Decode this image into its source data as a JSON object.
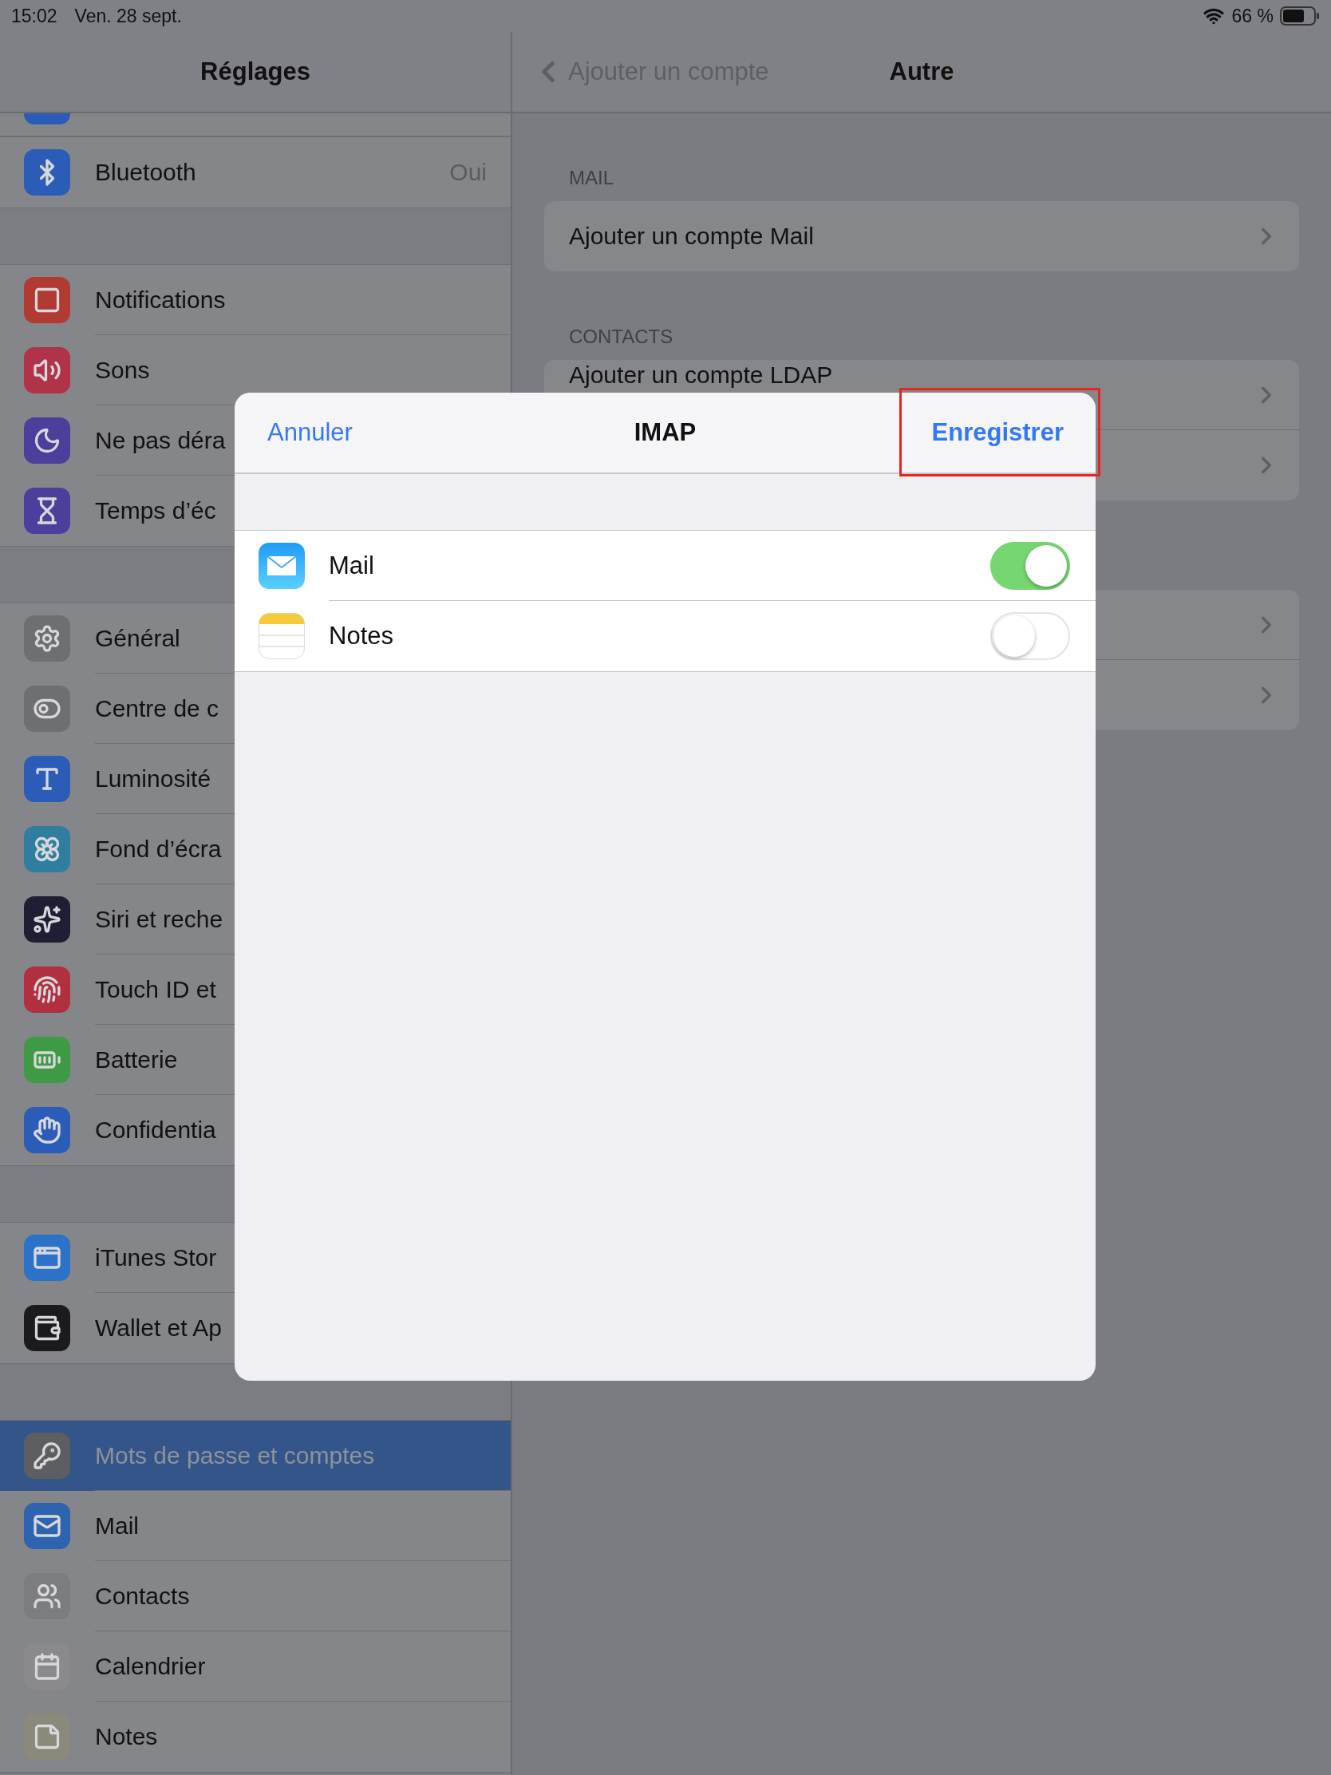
{
  "status_bar": {
    "time": "15:02",
    "date": "Ven. 28 sept.",
    "battery": "66 %"
  },
  "sidebar": {
    "title": "Réglages",
    "groups": [
      {
        "items": [
          {
            "label": "Bluetooth",
            "value": "Oui",
            "selected": false
          }
        ]
      },
      {
        "items": [
          {
            "label": "Notifications",
            "selected": false
          },
          {
            "label": "Sons",
            "selected": false
          },
          {
            "label": "Ne pas déra",
            "selected": false
          },
          {
            "label": "Temps d’éc",
            "selected": false
          }
        ]
      },
      {
        "items": [
          {
            "label": "Général",
            "selected": false
          },
          {
            "label": "Centre de c",
            "selected": false
          },
          {
            "label": "Luminosité",
            "selected": false
          },
          {
            "label": "Fond d’écra",
            "selected": false
          },
          {
            "label": "Siri et reche",
            "selected": false
          },
          {
            "label": "Touch ID et",
            "selected": false
          },
          {
            "label": "Batterie",
            "selected": false
          },
          {
            "label": "Confidentia",
            "selected": false
          }
        ]
      },
      {
        "items": [
          {
            "label": "iTunes Stor",
            "selected": false
          },
          {
            "label": "Wallet et Ap",
            "selected": false
          }
        ]
      },
      {
        "items": [
          {
            "label": "Mots de passe et comptes",
            "selected": true
          },
          {
            "label": "Mail",
            "selected": false
          },
          {
            "label": "Contacts",
            "selected": false
          },
          {
            "label": "Calendrier",
            "selected": false
          },
          {
            "label": "Notes",
            "selected": false
          }
        ]
      }
    ]
  },
  "detail": {
    "back": "Ajouter un compte",
    "title": "Autre",
    "sections": [
      {
        "header": "MAIL",
        "rows": [
          "Ajouter un compte Mail"
        ]
      },
      {
        "header": "CONTACTS",
        "rows": [
          "Ajouter un compte LDAP",
          ""
        ]
      },
      {
        "rows": [
          "",
          ""
        ]
      }
    ]
  },
  "modal": {
    "cancel": "Annuler",
    "title": "IMAP",
    "save": "Enregistrer",
    "rows": [
      {
        "label": "Mail",
        "on": true
      },
      {
        "label": "Notes",
        "on": false
      }
    ]
  }
}
